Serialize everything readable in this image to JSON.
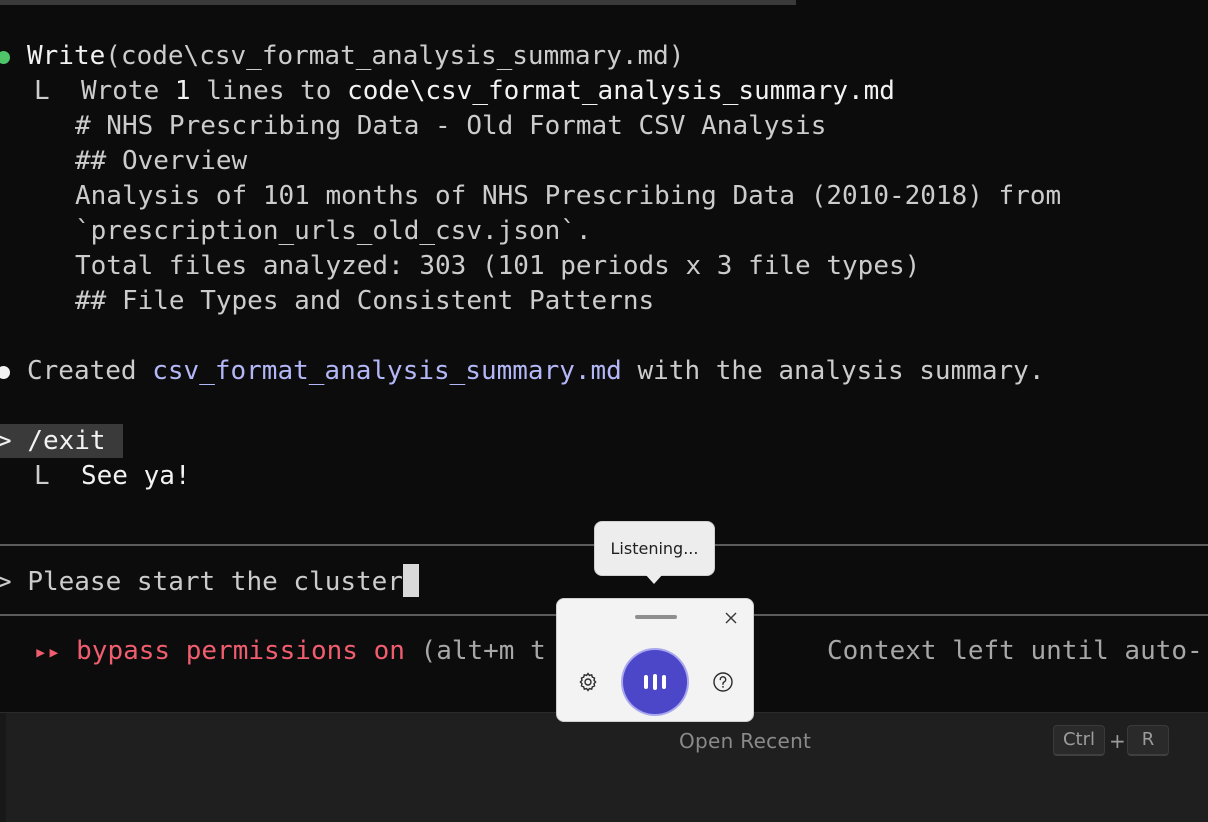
{
  "terminal": {
    "write_tool": "Write",
    "write_args": "(code\\csv_format_analysis_summary.md)",
    "tree_glyph": "L",
    "result_prefix": "Wrote ",
    "result_count": "1",
    "result_mid": " lines to ",
    "result_path": "code\\csv_format_analysis_summary.md",
    "content_lines": [
      "# NHS Prescribing Data - Old Format CSV Analysis",
      "## Overview",
      "Analysis of 101 months of NHS Prescribing Data (2010-2018) from",
      "`prescription_urls_old_csv.json`.",
      "Total files analyzed: 303 (101 periods x 3 file types)",
      "## File Types and Consistent Patterns"
    ],
    "created_prefix": "Created ",
    "created_file": "csv_format_analysis_summary.md",
    "created_suffix": " with the analysis summary.",
    "prompt_glyph": ">",
    "exit_command": "/exit",
    "exit_reply": "See ya!",
    "input_text": "Please start the cluster",
    "status_arrows": "▸▸",
    "status_mode": "bypass permissions on",
    "status_hint": " (alt+m t",
    "status_context": "Context left until auto-"
  },
  "bottom_panel": {
    "open_recent_label": "Open Recent",
    "shortcut_key_1": "Ctrl",
    "shortcut_plus": "+",
    "shortcut_key_2": "R"
  },
  "voice_widget": {
    "tooltip_text": "Listening...",
    "accent_color": "#4b47c8"
  }
}
